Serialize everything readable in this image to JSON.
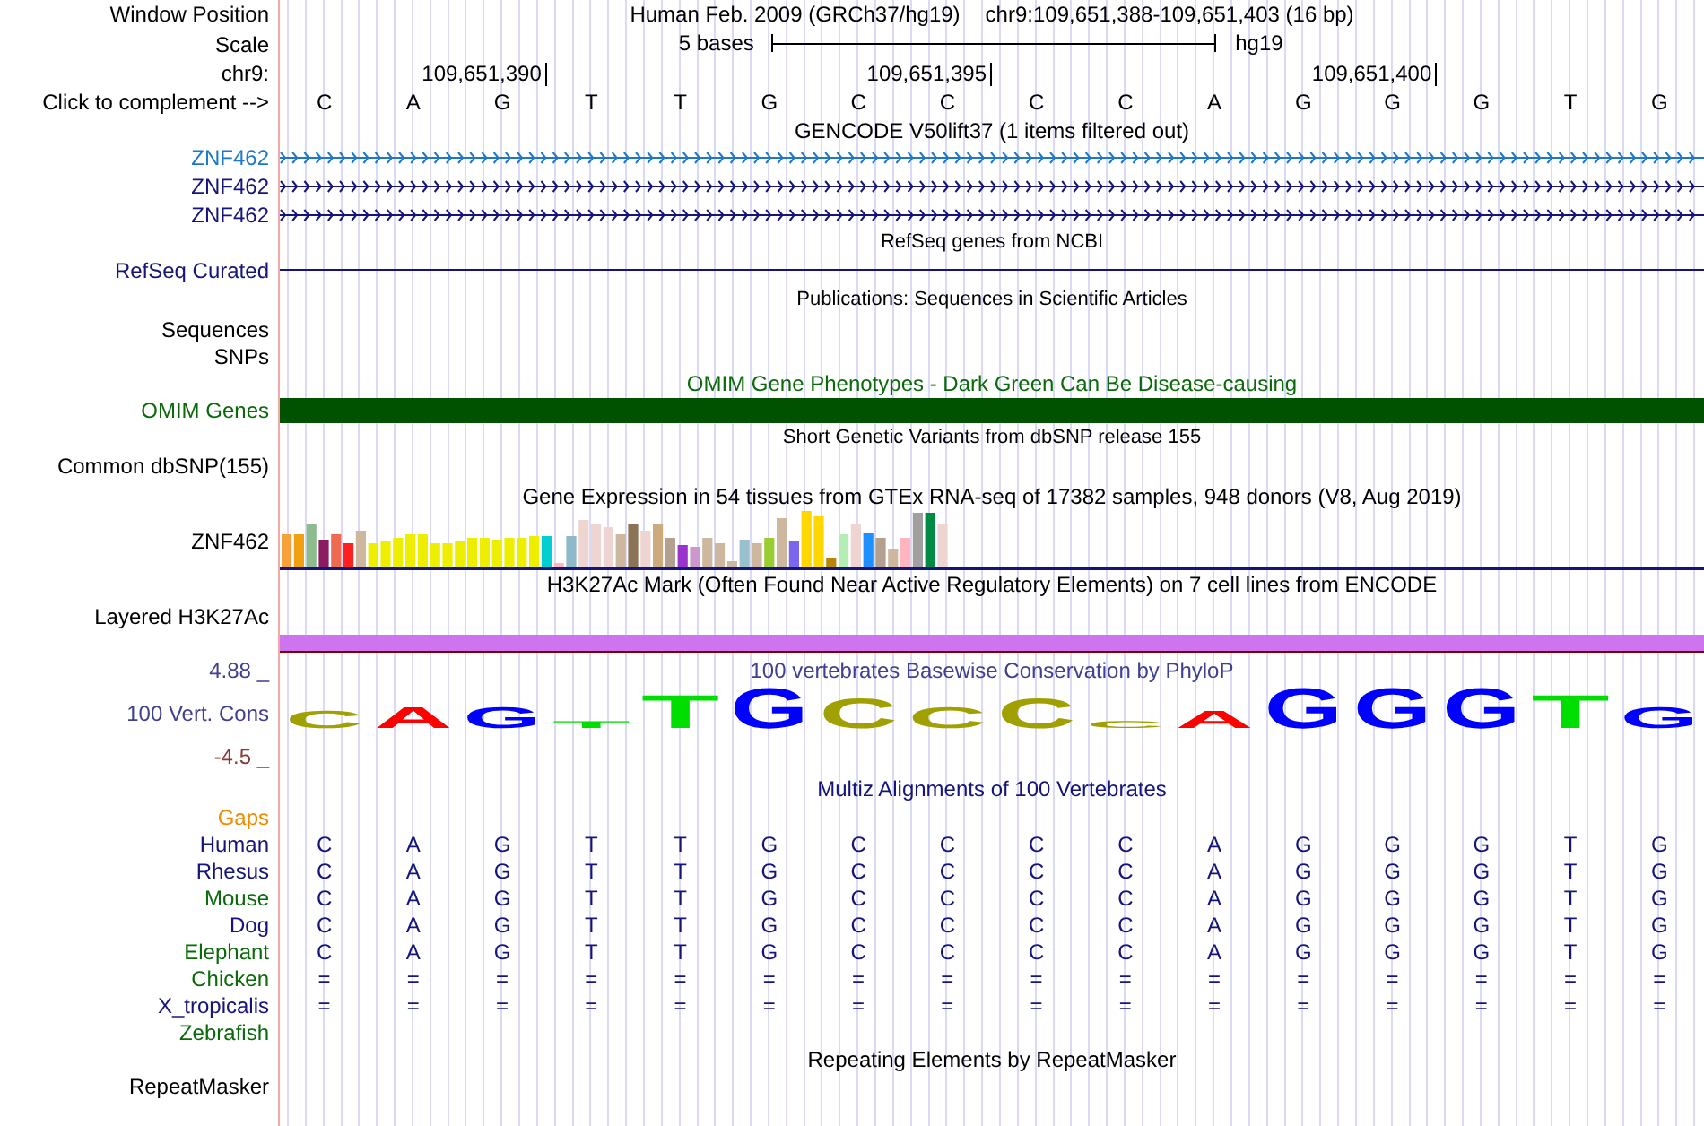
{
  "header": {
    "window_position_label": "Window Position",
    "assembly": "Human Feb. 2009 (GRCh37/hg19)",
    "position": "chr9:109,651,388-109,651,403 (16 bp)",
    "scale_label": "Scale",
    "scale_text": "5 bases",
    "scale_db": "hg19",
    "chrom_label": "chr9:",
    "ticks": [
      "109,651,390",
      "109,651,395",
      "109,651,400"
    ],
    "complement_label": "Click to complement -->",
    "bases": [
      "C",
      "A",
      "G",
      "T",
      "T",
      "G",
      "C",
      "C",
      "C",
      "C",
      "A",
      "G",
      "G",
      "G",
      "T",
      "G"
    ]
  },
  "gencode": {
    "title": "GENCODE V50lift37 (1 items filtered out)",
    "genes": [
      {
        "name": "ZNF462",
        "color": "#1e78c8"
      },
      {
        "name": "ZNF462",
        "color": "#14147a"
      },
      {
        "name": "ZNF462",
        "color": "#14147a"
      }
    ]
  },
  "refseq": {
    "title": "RefSeq genes from NCBI",
    "label": "RefSeq Curated"
  },
  "publications": {
    "title": "Publications: Sequences in Scientific Articles",
    "labels": [
      "Sequences",
      "SNPs"
    ]
  },
  "omim": {
    "title": "OMIM Gene Phenotypes - Dark Green Can Be Disease-causing",
    "label": "OMIM Genes"
  },
  "dbsnp": {
    "title": "Short Genetic Variants from dbSNP release 155",
    "label": "Common dbSNP(155)"
  },
  "gtex": {
    "title": "Gene Expression in 54 tissues from GTEx RNA-seq of 17382 samples, 948 donors (V8, Aug 2019)",
    "label": "ZNF462"
  },
  "h3k27ac": {
    "title": "H3K27Ac Mark (Often Found Near Active Regulatory Elements) on 7 cell lines from ENCODE",
    "label": "Layered H3K27Ac"
  },
  "phylop": {
    "title": "100 vertebrates Basewise Conservation by PhyloP",
    "label": "100 Vert. Cons",
    "max": "4.88 _",
    "min": "-4.5 _",
    "bases": [
      {
        "base": "C",
        "color": "#a0a000"
      },
      {
        "base": "A",
        "color": "#ff0000"
      },
      {
        "base": "G",
        "color": "#0000ff"
      },
      {
        "base": "T",
        "color": "#00dd00"
      },
      {
        "base": "T",
        "color": "#00dd00"
      },
      {
        "base": "G",
        "color": "#0000ff"
      },
      {
        "base": "C",
        "color": "#a0a000"
      },
      {
        "base": "C",
        "color": "#a0a000"
      },
      {
        "base": "C",
        "color": "#a0a000"
      },
      {
        "base": "C",
        "color": "#a0a000"
      },
      {
        "base": "A",
        "color": "#ff0000"
      },
      {
        "base": "G",
        "color": "#0000ff"
      },
      {
        "base": "G",
        "color": "#0000ff"
      },
      {
        "base": "G",
        "color": "#0000ff"
      },
      {
        "base": "T",
        "color": "#00dd00"
      },
      {
        "base": "G",
        "color": "#0000ff"
      }
    ]
  },
  "multiz": {
    "title": "Multiz Alignments of 100 Vertebrates",
    "gaps_label": "Gaps",
    "species": [
      {
        "name": "Human",
        "color": "#14147a",
        "bases": [
          "C",
          "A",
          "G",
          "T",
          "T",
          "G",
          "C",
          "C",
          "C",
          "C",
          "A",
          "G",
          "G",
          "G",
          "T",
          "G"
        ]
      },
      {
        "name": "Rhesus",
        "color": "#14147a",
        "bases": [
          "C",
          "A",
          "G",
          "T",
          "T",
          "G",
          "C",
          "C",
          "C",
          "C",
          "A",
          "G",
          "G",
          "G",
          "T",
          "G"
        ]
      },
      {
        "name": "Mouse",
        "color": "#0a6a0a",
        "bases": [
          "C",
          "A",
          "G",
          "T",
          "T",
          "G",
          "C",
          "C",
          "C",
          "C",
          "A",
          "G",
          "G",
          "G",
          "T",
          "G"
        ]
      },
      {
        "name": "Dog",
        "color": "#14147a",
        "bases": [
          "C",
          "A",
          "G",
          "T",
          "T",
          "G",
          "C",
          "C",
          "C",
          "C",
          "A",
          "G",
          "G",
          "G",
          "T",
          "G"
        ]
      },
      {
        "name": "Elephant",
        "color": "#0a6a0a",
        "bases": [
          "C",
          "A",
          "G",
          "T",
          "T",
          "G",
          "C",
          "C",
          "C",
          "C",
          "A",
          "G",
          "G",
          "G",
          "T",
          "G"
        ]
      },
      {
        "name": "Chicken",
        "color": "#0a6a0a",
        "bases": [
          "=",
          "=",
          "=",
          "=",
          "=",
          "=",
          "=",
          "=",
          "=",
          "=",
          "=",
          "=",
          "=",
          "=",
          "=",
          "="
        ]
      },
      {
        "name": "X_tropicalis",
        "color": "#14147a",
        "bases": [
          "=",
          "=",
          "=",
          "=",
          "=",
          "=",
          "=",
          "=",
          "=",
          "=",
          "=",
          "=",
          "=",
          "=",
          "=",
          "="
        ]
      },
      {
        "name": "Zebrafish",
        "color": "#0a6a0a"
      }
    ]
  },
  "repeatmasker": {
    "title": "Repeating Elements by RepeatMasker",
    "label": "RepeatMasker"
  }
}
